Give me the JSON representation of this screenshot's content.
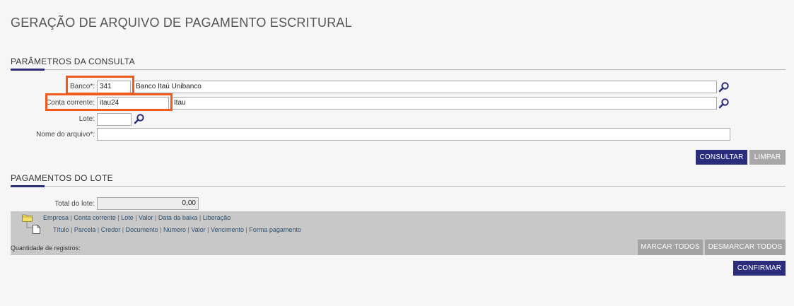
{
  "page": {
    "title": "GERAÇÃO DE ARQUIVO DE PAGAMENTO ESCRITURAL"
  },
  "params": {
    "section_title": "PARÂMETROS DA CONSULTA",
    "banco_label": "Banco*:",
    "banco_code": "341",
    "banco_name": "Banco Itaú Unibanco",
    "conta_label": "Conta corrente:",
    "conta_code": "itau24",
    "conta_name": "Itau",
    "lote_label": "Lote:",
    "lote_value": "",
    "arquivo_label": "Nome do arquivo*:",
    "arquivo_value": "",
    "consultar_label": "CONSULTAR",
    "limpar_label": "LIMPAR"
  },
  "payments": {
    "section_title": "PAGAMENTOS DO LOTE",
    "total_label": "Total do lote:",
    "total_value": "0,00",
    "tree_parent": [
      "Empresa",
      "Conta corrente",
      "Lote",
      "Valor",
      "Data da baixa",
      "Liberação"
    ],
    "tree_child": [
      "Título",
      "Parcela",
      "Credor",
      "Documento",
      "Número",
      "Valor",
      "Vencimento",
      "Forma pagamento"
    ],
    "count_label": "Quantidade de registros:",
    "marcar_label": "MARCAR TODOS",
    "desmarcar_label": "DESMARCAR TODOS",
    "confirmar_label": "CONFIRMAR"
  },
  "colors": {
    "accent": "#2b2d7c",
    "highlight": "#f05a1a",
    "link": "#2e4f6e"
  },
  "icons": [
    "search-icon",
    "folder-icon",
    "document-icon"
  ]
}
